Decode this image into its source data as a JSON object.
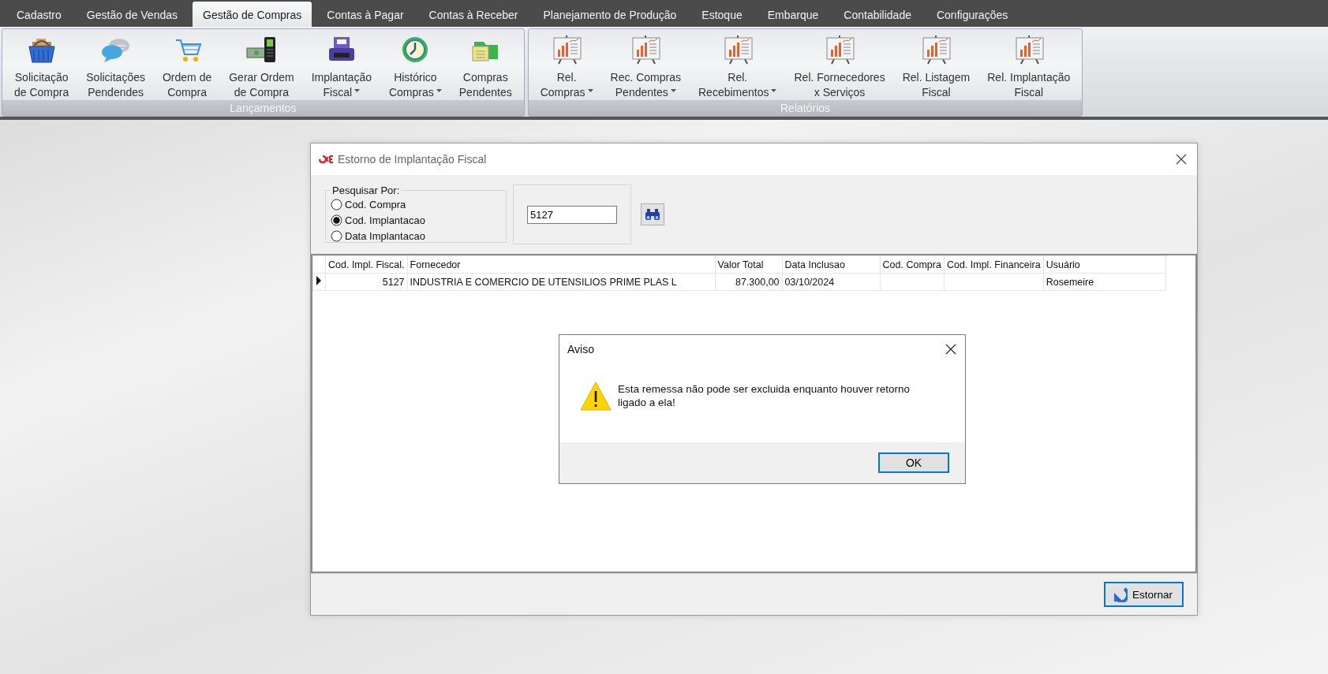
{
  "menu_tabs": [
    {
      "label": "Cadastro",
      "selected": false
    },
    {
      "label": "Gestão de Vendas",
      "selected": false
    },
    {
      "label": "Gestão de Compras",
      "selected": true
    },
    {
      "label": "Contas à Pagar",
      "selected": false
    },
    {
      "label": "Contas à Receber",
      "selected": false
    },
    {
      "label": "Planejamento de Produção",
      "selected": false
    },
    {
      "label": "Estoque",
      "selected": false
    },
    {
      "label": "Embarque",
      "selected": false
    },
    {
      "label": "Contabilidade",
      "selected": false
    },
    {
      "label": "Configurações",
      "selected": false
    }
  ],
  "ribbon": {
    "groups": [
      {
        "label": "Lançamentos",
        "items": [
          {
            "lines": [
              "Solicitação",
              "de Compra"
            ],
            "dropdown": false
          },
          {
            "lines": [
              "Solicitações",
              "Pendendes"
            ],
            "dropdown": false
          },
          {
            "lines": [
              "Ordem de",
              "Compra"
            ],
            "dropdown": false
          },
          {
            "lines": [
              "Gerar Ordem",
              "de Compra"
            ],
            "dropdown": false
          },
          {
            "lines": [
              "Implantação",
              "Fiscal"
            ],
            "dropdown": true
          },
          {
            "lines": [
              "Histórico",
              "Compras"
            ],
            "dropdown": true
          },
          {
            "lines": [
              "Compras",
              "Pendentes"
            ],
            "dropdown": false
          }
        ]
      },
      {
        "label": "Relatórios",
        "items": [
          {
            "lines": [
              "Rel.",
              "Compras"
            ],
            "dropdown": true
          },
          {
            "lines": [
              "Rec. Compras",
              "Pendentes"
            ],
            "dropdown": true
          },
          {
            "lines": [
              "Rel.",
              "Recebimentos"
            ],
            "dropdown": true
          },
          {
            "lines": [
              "Rel. Fornecedores",
              "x Serviços"
            ],
            "dropdown": false
          },
          {
            "lines": [
              "Rel. Listagem",
              "Fiscal"
            ],
            "dropdown": false
          },
          {
            "lines": [
              "Rel. Implantação",
              "Fiscal"
            ],
            "dropdown": false
          }
        ]
      }
    ]
  },
  "dialog": {
    "title": "Estorno de Implantação Fiscal",
    "search": {
      "legend": "Pesquisar Por:",
      "options": [
        {
          "label": "Cod. Compra",
          "selected": false
        },
        {
          "label": "Cod. Implantacao",
          "selected": true
        },
        {
          "label": "Data Implantacao",
          "selected": false
        }
      ],
      "value": "5127"
    },
    "table": {
      "columns": [
        "Cod. Impl. Fiscal.",
        "Fornecedor",
        "Valor Total",
        "Data Inclusao",
        "Cod. Compra",
        "Cod. Impl. Financeira",
        "Usuário"
      ],
      "rows": [
        {
          "current": true,
          "cells": [
            "5127",
            "INDUSTRIA E COMERCIO DE UTENSILIOS PRIME PLAS L",
            "87.300,00",
            "03/10/2024",
            "",
            "",
            "Rosemeire"
          ]
        }
      ]
    },
    "buttons": [
      {
        "label": "Estornar",
        "default": true
      }
    ]
  },
  "alert": {
    "title": "Aviso",
    "message": "Esta remessa não pode ser excluida enquanto houver retorno ligado a ela!",
    "buttons": [
      {
        "label": "OK",
        "default": true
      }
    ]
  }
}
